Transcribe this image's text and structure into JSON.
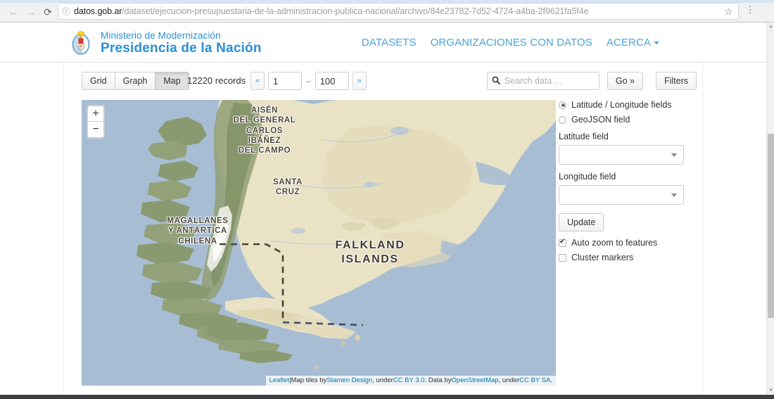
{
  "browser": {
    "back_icon": "←",
    "forward_icon": "→",
    "reload_icon": "⟳",
    "site_info_icon": "ⓘ",
    "url_host": "datos.gob.ar",
    "url_path": "/dataset/ejecucion-presupuestaria-de-la-administracion-publica-nacional/archivo/84e23782-7d52-4724-a4ba-2f9621fa5f4e",
    "star_icon": "☆",
    "menu_icon": "⋮"
  },
  "header": {
    "brand_line1": "Ministerio de Modernización",
    "brand_line2": "Presidencia de la Nación",
    "brand_color": "#2a8fd4",
    "nav": [
      {
        "label": "DATASETS"
      },
      {
        "label": "ORGANIZACIONES CON DATOS"
      },
      {
        "label": "ACERCA"
      }
    ]
  },
  "toolbar": {
    "views": [
      {
        "label": "Grid",
        "active": false
      },
      {
        "label": "Graph",
        "active": false
      },
      {
        "label": "Map",
        "active": true
      }
    ],
    "record_count": "12220 records",
    "pager": {
      "prev_icon": "«",
      "next_icon": "»",
      "from": "1",
      "to": "100",
      "dash": "–"
    },
    "search": {
      "icon": "search-icon",
      "glyph": "🔍",
      "value": "",
      "placeholder": "Search data ..."
    },
    "go_label": "Go »",
    "filters_label": "Filters"
  },
  "map": {
    "zoom_in": "+",
    "zoom_out": "−",
    "ocean_color": "#a7bdd4",
    "land_color": "#e9e2c4",
    "forest_color": "#93a178",
    "labels": [
      {
        "text": "AISÉN\nDEL GENERAL\nCARLOS\nIBÁÑEZ\nDEL CAMPO"
      },
      {
        "text": "SANTA\nCRUZ"
      },
      {
        "text": "MAGALLANES\nY ANTÁRTICA\nCHILENA"
      },
      {
        "text": "FALKLAND\nISLANDS"
      }
    ],
    "attribution": {
      "leaflet": "Leaflet",
      "sep": " | ",
      "tiles_by": "Map tiles by ",
      "stamen": "Stamen Design",
      "under1": ", under ",
      "ccby30": "CC BY 3.0",
      "data_by": ". Data by ",
      "osm": "OpenStreetMap",
      "under2": ", under ",
      "ccbysa": "CC BY SA",
      "end": "."
    }
  },
  "map_controls": {
    "source_options": [
      {
        "label": "Latitude / Longitude fields",
        "selected": true
      },
      {
        "label": "GeoJSON field",
        "selected": false
      }
    ],
    "latitude_label": "Latitude field",
    "latitude_value": "",
    "longitude_label": "Longitude field",
    "longitude_value": "",
    "update_label": "Update",
    "checkboxes": [
      {
        "label": "Auto zoom to features",
        "checked": true
      },
      {
        "label": "Cluster markers",
        "checked": false
      }
    ]
  }
}
